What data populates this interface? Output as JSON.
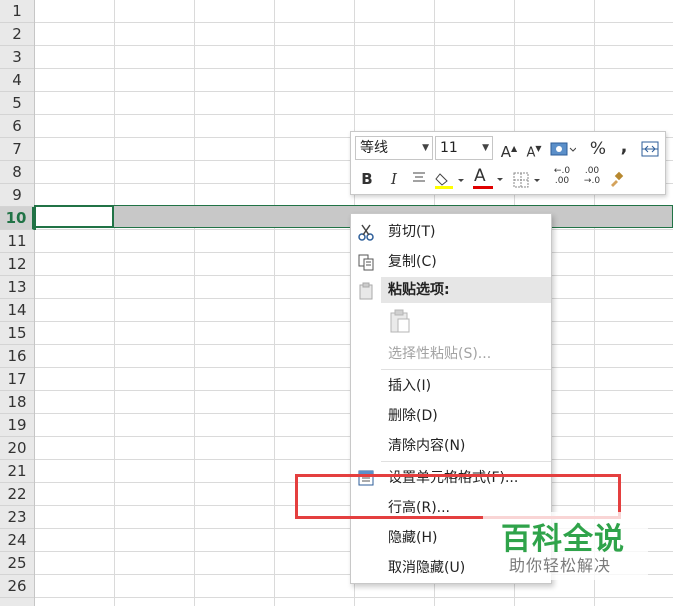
{
  "spreadsheet": {
    "row_numbers": [
      "1",
      "2",
      "3",
      "4",
      "5",
      "6",
      "7",
      "8",
      "9",
      "10",
      "11",
      "12",
      "13",
      "14",
      "15",
      "16",
      "17",
      "18",
      "19",
      "20",
      "21",
      "22",
      "23",
      "24",
      "25",
      "26"
    ],
    "selected_row": "10"
  },
  "mini_toolbar": {
    "font_name": "等线",
    "font_size": "11",
    "grow_font_label": "A",
    "shrink_font_label": "A",
    "percent_label": "%",
    "comma_label": ",",
    "bold_label": "B",
    "italic_label": "I",
    "font_color_label": "A",
    "increase_decimal_label": "←.0 .00",
    "decrease_decimal_label": ".00 →.0",
    "colors": {
      "highlight": "#ffff00",
      "font_color": "#e00000"
    }
  },
  "context_menu": {
    "items": [
      {
        "label": "剪切(T)",
        "icon": "scissors-icon",
        "enabled": true
      },
      {
        "label": "复制(C)",
        "icon": "copy-icon",
        "enabled": true
      },
      {
        "label": "粘贴选项:",
        "icon": "paste-icon",
        "enabled": false
      },
      {
        "label": "",
        "icon": "paste-clipboard-icon",
        "enabled": false
      },
      {
        "label": "选择性粘贴(S)...",
        "icon": "",
        "enabled": false
      },
      {
        "label": "插入(I)",
        "icon": "",
        "enabled": true
      },
      {
        "label": "删除(D)",
        "icon": "",
        "enabled": true
      },
      {
        "label": "清除内容(N)",
        "icon": "",
        "enabled": true
      },
      {
        "label": "设置单元格格式(F)...",
        "icon": "format-cells-icon",
        "enabled": true
      },
      {
        "label": "行高(R)...",
        "icon": "",
        "enabled": true
      },
      {
        "label": "隐藏(H)",
        "icon": "",
        "enabled": true
      },
      {
        "label": "取消隐藏(U)",
        "icon": "",
        "enabled": true
      }
    ]
  },
  "watermark": {
    "title": "百科全说",
    "subtitle": "助你轻松解决",
    "colors": {
      "title": "#2fa34a",
      "highlight_box": "#e43f3f"
    }
  }
}
